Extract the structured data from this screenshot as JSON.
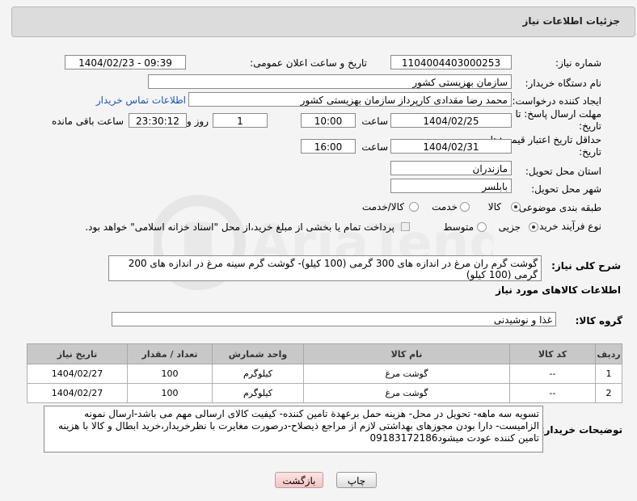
{
  "panel_title": "جزئیات اطلاعات نیاز",
  "fields": {
    "need_number_label": "شماره نیاز:",
    "need_number": "1104004403000253",
    "announce_label": "تاریخ و ساعت اعلان عمومی:",
    "announce_value": "1404/02/23 - 09:39",
    "buyer_org_label": "نام دستگاه خریدار:",
    "buyer_org": "سازمان بهزیستی کشور",
    "requester_label": "ایجاد کننده درخواست:",
    "requester": "محمد رضا  مقدادی کارپرداز سازمان بهزیستی کشور",
    "contact_link": "اطلاعات تماس خریدار",
    "deadline_label": "مهلت ارسال پاسخ: تا تاریخ:",
    "deadline_date": "1404/02/25",
    "time_label": "ساعت",
    "deadline_time": "10:00",
    "days_value": "1",
    "days_label": "روز و",
    "remaining_time": "23:30:12",
    "remaining_label": "ساعت باقی مانده",
    "validity_label": "حداقل تاریخ اعتبار قیمت: تا تاریخ:",
    "validity_date": "1404/02/31",
    "validity_time_label": "ساعت",
    "validity_time": "16:00",
    "province_label": "استان محل تحویل:",
    "province": "مازندران",
    "city_label": "شهر محل تحویل:",
    "city": "بابلسر",
    "category_label": "طبقه بندی موضوعی:",
    "category_options": [
      "کالا",
      "خدمت",
      "کالا/خدمت"
    ],
    "category_selected": "کالا",
    "process_label": "نوع فرآیند خرید :",
    "process_options": [
      "جزیی",
      "متوسط"
    ],
    "process_selected": "جزیی",
    "payment_note": "پرداخت تمام یا بخشی از مبلغ خرید،از محل \"اسناد خزانه اسلامی\" خواهد بود."
  },
  "description": {
    "label": "شرح کلی نیاز:",
    "text": "گوشت گرم ران مرغ در اندازه های 300 گرمی (100 کیلو)- گوشت گرم سینه مرغ در اندازه های 200 گرمی (100 کیلو)"
  },
  "goods_section_title": "اطلاعات کالاهای مورد نیاز",
  "goods_group": {
    "label": "گروه کالا:",
    "value": "غذا و نوشیدنی"
  },
  "table": {
    "headers": [
      "ردیف",
      "کد کالا",
      "نام کالا",
      "واحد شمارش",
      "تعداد / مقدار",
      "تاریخ نیاز"
    ],
    "rows": [
      [
        "1",
        "--",
        "گوشت مرغ",
        "کیلوگرم",
        "100",
        "1404/02/27"
      ],
      [
        "2",
        "--",
        "گوشت مرغ",
        "کیلوگرم",
        "100",
        "1404/02/27"
      ]
    ]
  },
  "buyer_notes": {
    "label": "توضیحات خریدار:",
    "text": "تسویه سه ماهه- تحویل در محل- هزینه حمل برعهدة تامین کننده- کیفیت کالای ارسالی مهم می باشد-ارسال نمونه الزامیست- دارا بودن مجوزهای بهداشتی لازم از مراجع ذیصلاح-درصورت مغایرت با نظرخریدار،خرید ابطال و کالا با هزینه تامین کننده عودت میشود09183172186"
  },
  "buttons": {
    "print": "چاپ",
    "back": "بازگشت"
  },
  "colors": {
    "link": "#1a56b8",
    "header_bg": "#c8c8c8",
    "back_button": "#f3c4c4"
  }
}
